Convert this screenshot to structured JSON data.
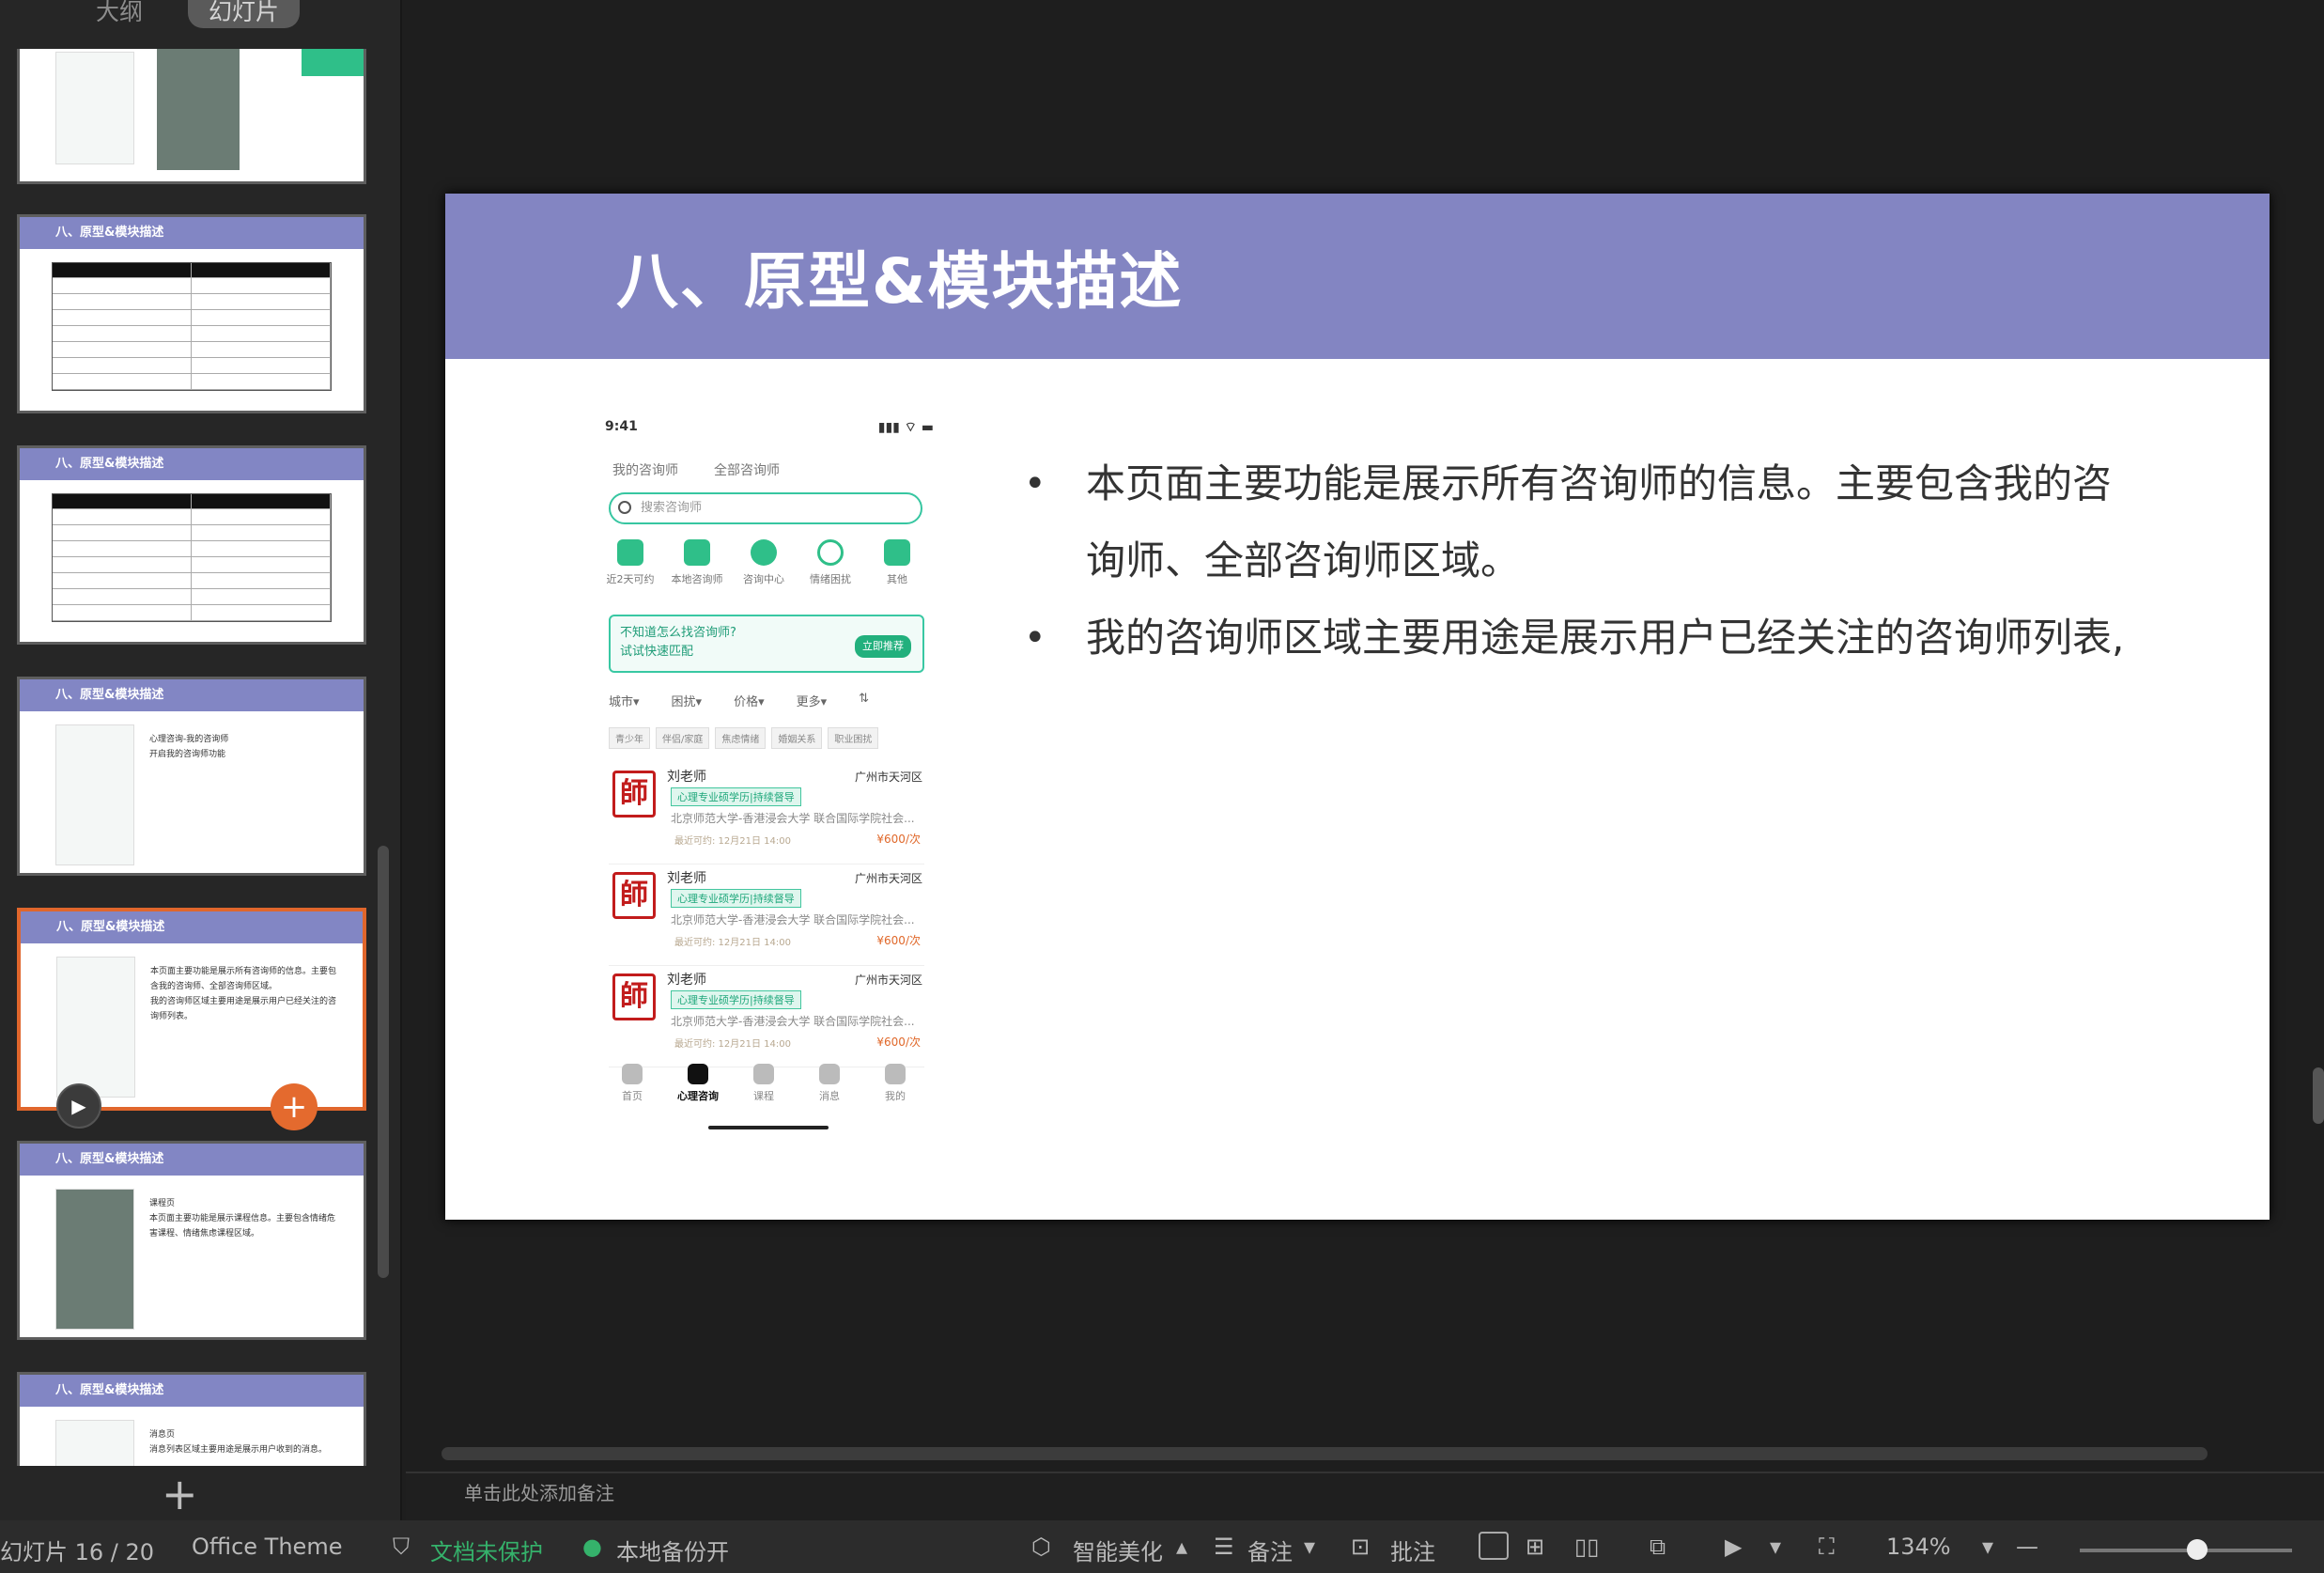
{
  "view_tabs": {
    "outline": "大纲",
    "slides": "幻灯片"
  },
  "thumbnails": [
    {
      "title": "八、原型&模块描述",
      "kind": "table"
    },
    {
      "title": "八、原型&模块描述",
      "kind": "table"
    },
    {
      "title": "八、原型&模块描述",
      "kind": "phone",
      "bullets": [
        "心理咨询-我的咨询师",
        "开启我的咨询师功能"
      ]
    },
    {
      "title": "八、原型&模块描述",
      "kind": "phone",
      "bullets": [
        "本页面主要功能是展示所有咨询师的信息。主要包含我的咨询师、全部咨询师区域。",
        "我的咨询师区域主要用途是展示用户已经关注的咨询师列表。"
      ]
    },
    {
      "title": "八、原型&模块描述",
      "kind": "phone",
      "bullets": [
        "课程页",
        "本页面主要功能是展示课程信息。主要包含情绪危害课程、情绪焦虑课程区域。"
      ]
    },
    {
      "title": "八、原型&模块描述",
      "kind": "phone",
      "bullets": [
        "消息页",
        "消息列表区域主要用途是展示用户收到的消息。"
      ]
    }
  ],
  "slide": {
    "title": "八、原型&模块描述",
    "bullets": [
      "本页面主要功能是展示所有咨询师的信息。主要包含我的咨询师、全部咨询师区域。",
      "我的咨询师区域主要用途是展示用户已经关注的咨询师列表,"
    ]
  },
  "phone": {
    "time": "9:41",
    "tabs": [
      "我的咨询师",
      "全部咨询师"
    ],
    "search_placeholder": "搜索咨询师",
    "categories": [
      "近2天可约",
      "本地咨询师",
      "咨询中心",
      "情绪困扰",
      "其他"
    ],
    "banner_line1": "不知道怎么找咨询师?",
    "banner_line2": "试试快速匹配",
    "banner_button": "立即推荐",
    "filters": [
      "城市▾",
      "困扰▾",
      "价格▾",
      "更多▾"
    ],
    "tags": [
      "青少年",
      "伴侣/家庭",
      "焦虑情绪",
      "婚姻关系",
      "职业困扰"
    ],
    "cards": [
      {
        "name": "刘老师",
        "location": "广州市天河区",
        "badge": "心理专业硕学历|持续督导",
        "school": "北京师范大学-香港浸会大学 联合国际学院社会...",
        "time": "最近可约: 12月21日 14:00",
        "price": "¥600/次"
      },
      {
        "name": "刘老师",
        "location": "广州市天河区",
        "badge": "心理专业硕学历|持续督导",
        "school": "北京师范大学-香港浸会大学 联合国际学院社会...",
        "time": "最近可约: 12月21日 14:00",
        "price": "¥600/次"
      },
      {
        "name": "刘老师",
        "location": "广州市天河区",
        "badge": "心理专业硕学历|持续督导",
        "school": "北京师范大学-香港浸会大学 联合国际学院社会...",
        "time": "最近可约: 12月21日 14:00",
        "price": "¥600/次"
      }
    ],
    "seal_char": "師",
    "tabbar": [
      "首页",
      "心理咨询",
      "课程",
      "消息",
      "我的"
    ]
  },
  "notes_placeholder": "单击此处添加备注",
  "statusbar": {
    "slide_counter": "幻灯片 16 / 20",
    "theme": "Office Theme",
    "protect": "文档未保护",
    "backup": "本地备份开",
    "beautify": "智能美化",
    "notes": "备注",
    "comment": "批注",
    "zoom": "134%"
  },
  "colors": {
    "accent": "#8385c2",
    "active_border": "#e0662c",
    "green": "#35b26b"
  }
}
